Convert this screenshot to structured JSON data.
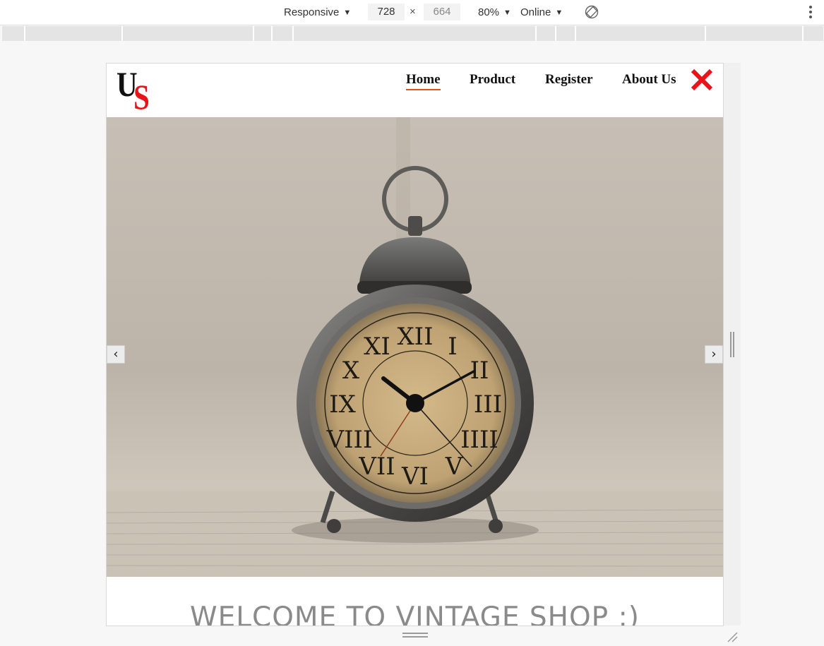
{
  "devtools": {
    "device_mode": "Responsive",
    "width": "728",
    "height": "664",
    "times_sign": "×",
    "zoom": "80%",
    "network": "Online",
    "icons": [
      "caret-down-icon",
      "rotate-icon",
      "more-vertical-icon"
    ]
  },
  "site": {
    "logo": {
      "first": "U",
      "second": "S"
    },
    "nav": [
      {
        "label": "Home",
        "active": true
      },
      {
        "label": "Product",
        "active": false
      },
      {
        "label": "Register",
        "active": false
      },
      {
        "label": "About Us",
        "active": false
      }
    ],
    "close_icon": "close-icon",
    "slider": {
      "prev": "‹",
      "next": "›",
      "image": "vintage-alarm-clock-on-newspaper"
    },
    "welcome": "WELCOME TO VINTAGE SHOP :)"
  },
  "colors": {
    "accent_red": "#e8141a",
    "nav_underline": "#e8501a",
    "welcome_text": "#8a8a8a"
  }
}
